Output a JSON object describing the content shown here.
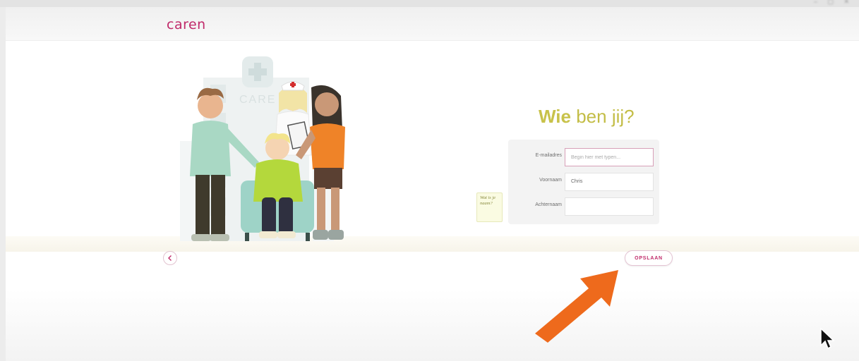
{
  "brand": {
    "name": "caren",
    "color": "#c02a6a"
  },
  "heading": {
    "bold": "Wie",
    "rest": " ben jij?"
  },
  "form": {
    "email_label": "E-mailadres",
    "email_value": "",
    "email_placeholder": "Begin hier met typen...",
    "firstname_label": "Voornaam",
    "firstname_value": "Chris",
    "lastname_label": "Achternaam",
    "lastname_value": ""
  },
  "tooltip": {
    "text": "Wat is je naam?"
  },
  "illustration": {
    "sign": "CARE"
  },
  "actions": {
    "save_label": "OPSLAAN",
    "back_icon": "chevron-left-icon"
  },
  "annotation": {
    "arrow_color": "#ee6a1c"
  },
  "colors": {
    "accent": "#c02a6a",
    "heading": "#c8c24a"
  }
}
